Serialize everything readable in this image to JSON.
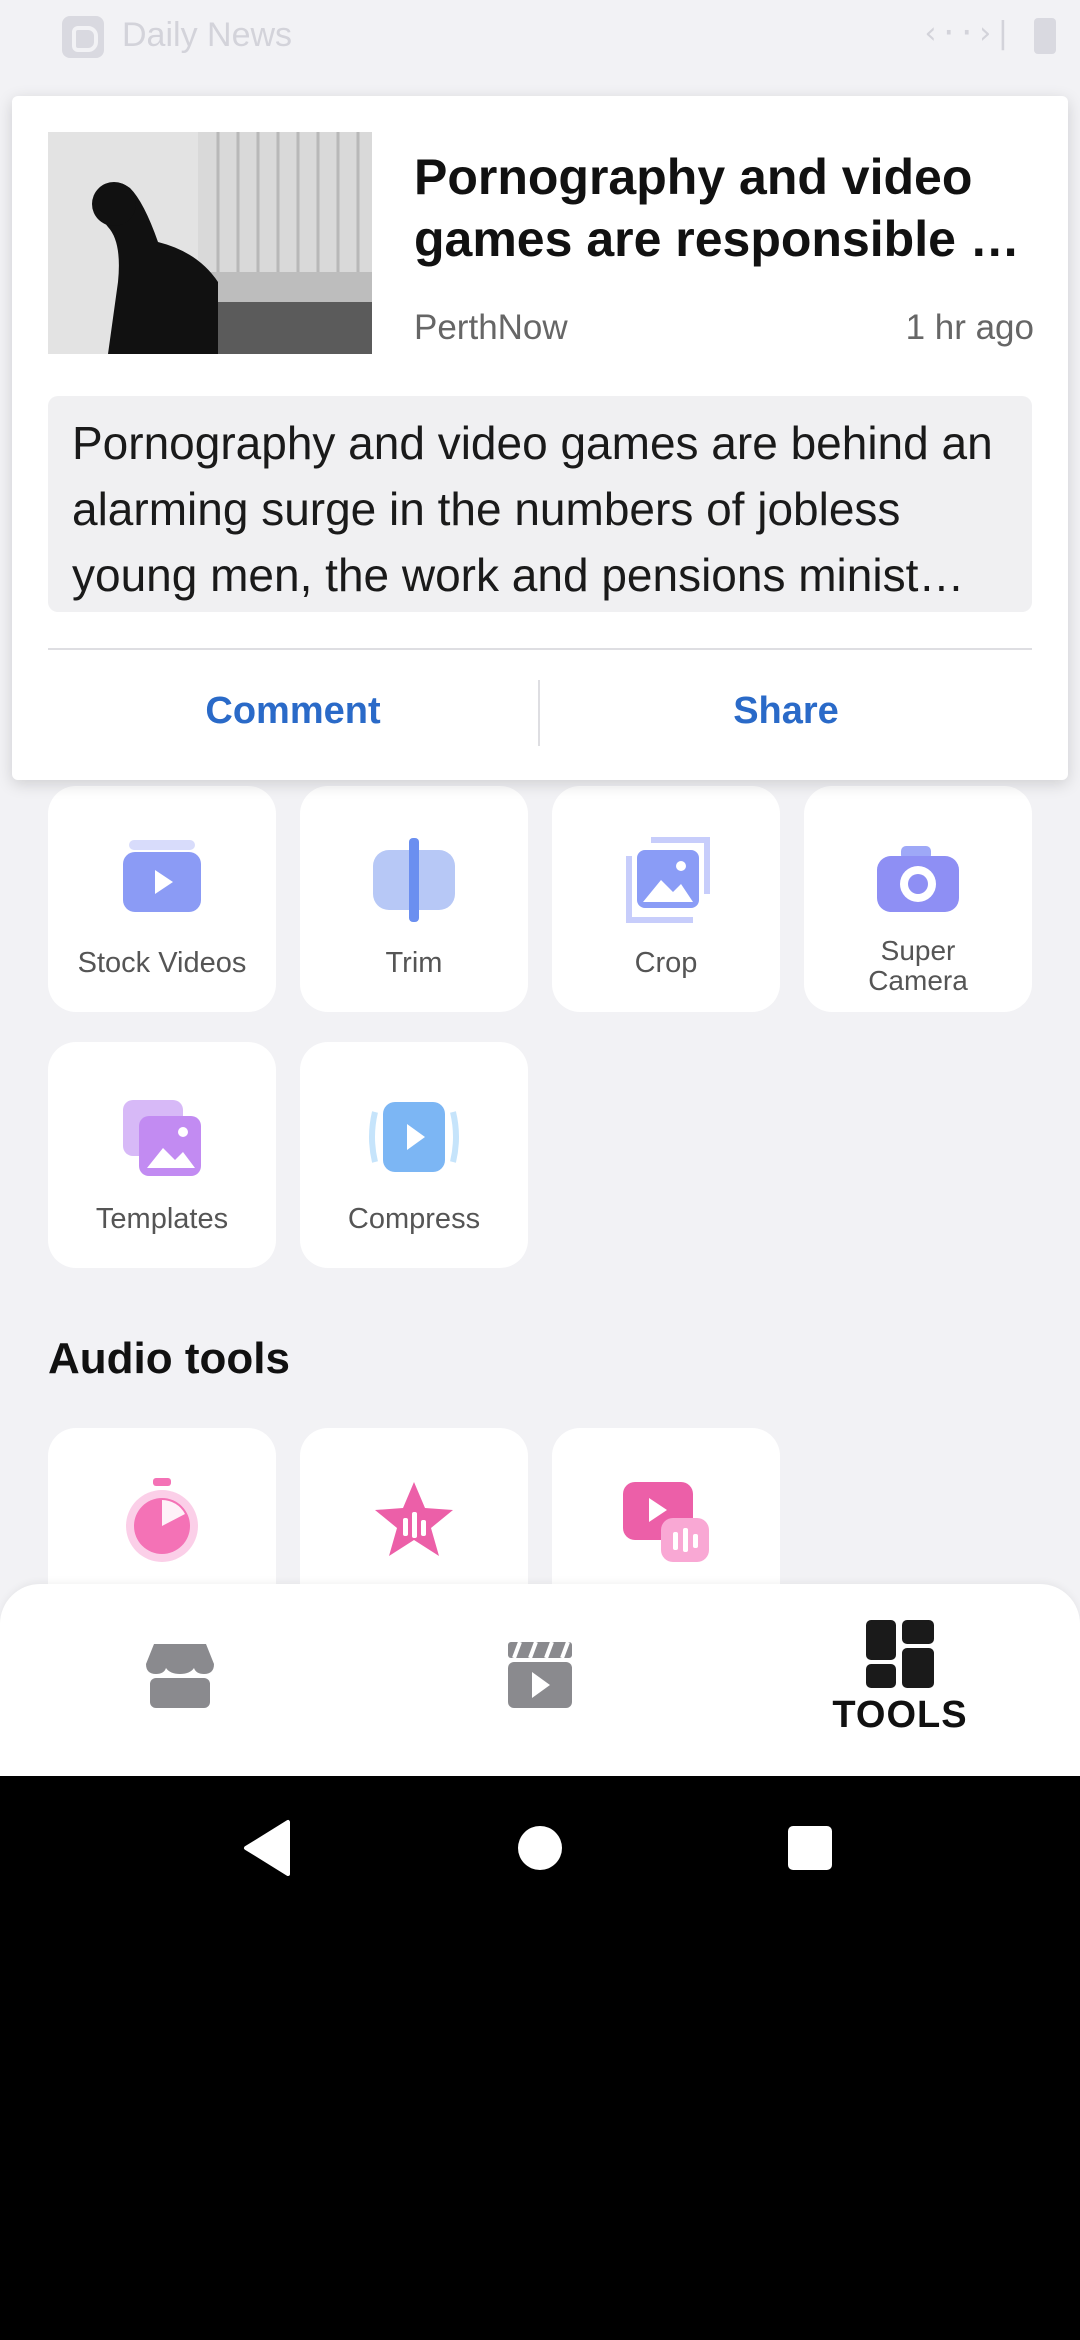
{
  "status_bar": {
    "app_title": "Daily News",
    "right_code": "‹··›|"
  },
  "notification": {
    "headline": "Pornography and video games are responsible …",
    "source": "PerthNow",
    "time": "1 hr ago",
    "summary": "Pornography and video games are behind an alarming surge in the numbers of jobless young men, the work and pensions minist…",
    "actions": {
      "comment": "Comment",
      "share": "Share"
    }
  },
  "tools": [
    {
      "label": "Stock Videos",
      "icon": "stock-videos-icon"
    },
    {
      "label": "Trim",
      "icon": "trim-icon"
    },
    {
      "label": "Crop",
      "icon": "crop-icon"
    },
    {
      "label_line1": "Super",
      "label_line2": "Camera",
      "icon": "super-camera-icon"
    },
    {
      "label": "Templates",
      "icon": "templates-icon"
    },
    {
      "label": "Compress",
      "icon": "compress-icon"
    }
  ],
  "audio_tools": {
    "title": "Audio tools",
    "icons": [
      "timer-music-icon",
      "star-audio-icon",
      "video-audio-icon"
    ]
  },
  "bottom_nav": {
    "items": [
      {
        "icon": "store-icon"
      },
      {
        "icon": "clapperboard-icon"
      },
      {
        "icon": "tools-grid-icon",
        "label": "TOOLS"
      }
    ],
    "active": "TOOLS"
  },
  "colors": {
    "accent": "#2a6ac8",
    "tool_icon_blue": "#6aa2f0",
    "tool_icon_purple": "#a78bfa",
    "audio_pink": "#f472b6"
  }
}
